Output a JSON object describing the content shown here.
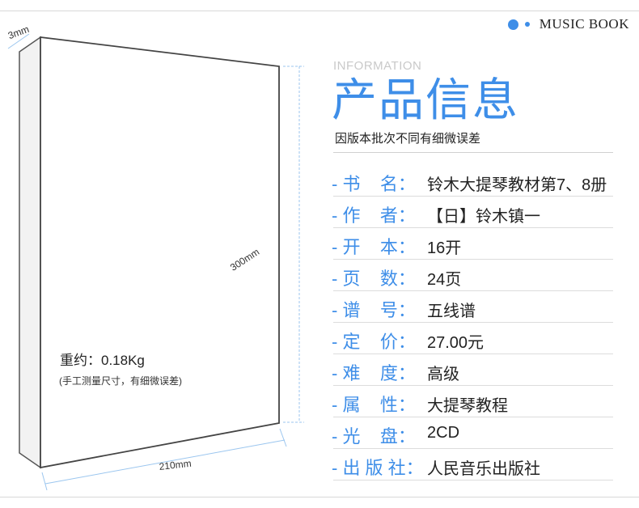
{
  "brand": {
    "text": "MUSIC BOOK",
    "accent_color": "#3e8ee8"
  },
  "header": {
    "info_en": "INFORMATION",
    "title": "产品信息",
    "subtitle": "因版本批次不同有细微误差"
  },
  "book": {
    "depth_label": "3mm",
    "height_label": "300mm",
    "width_label": "210mm",
    "weight": "重约：0.18Kg",
    "weight_note": "(手工测量尺寸，有细微误差)"
  },
  "details": [
    {
      "label": "- 书    名：",
      "value": "铃木大提琴教材第7、8册"
    },
    {
      "label": "- 作    者：",
      "value": "【日】铃木镇一"
    },
    {
      "label": "- 开    本：",
      "value": "16开"
    },
    {
      "label": "- 页    数：",
      "value": "24页"
    },
    {
      "label": "- 谱    号：",
      "value": "五线谱"
    },
    {
      "label": "- 定    价：",
      "value": "27.00元"
    },
    {
      "label": "- 难    度：",
      "value": "高级"
    },
    {
      "label": "- 属    性：",
      "value": "大提琴教程"
    },
    {
      "label": "- 光    盘：",
      "value": "2CD"
    },
    {
      "label": "- 出 版 社：",
      "value": "人民音乐出版社"
    }
  ]
}
